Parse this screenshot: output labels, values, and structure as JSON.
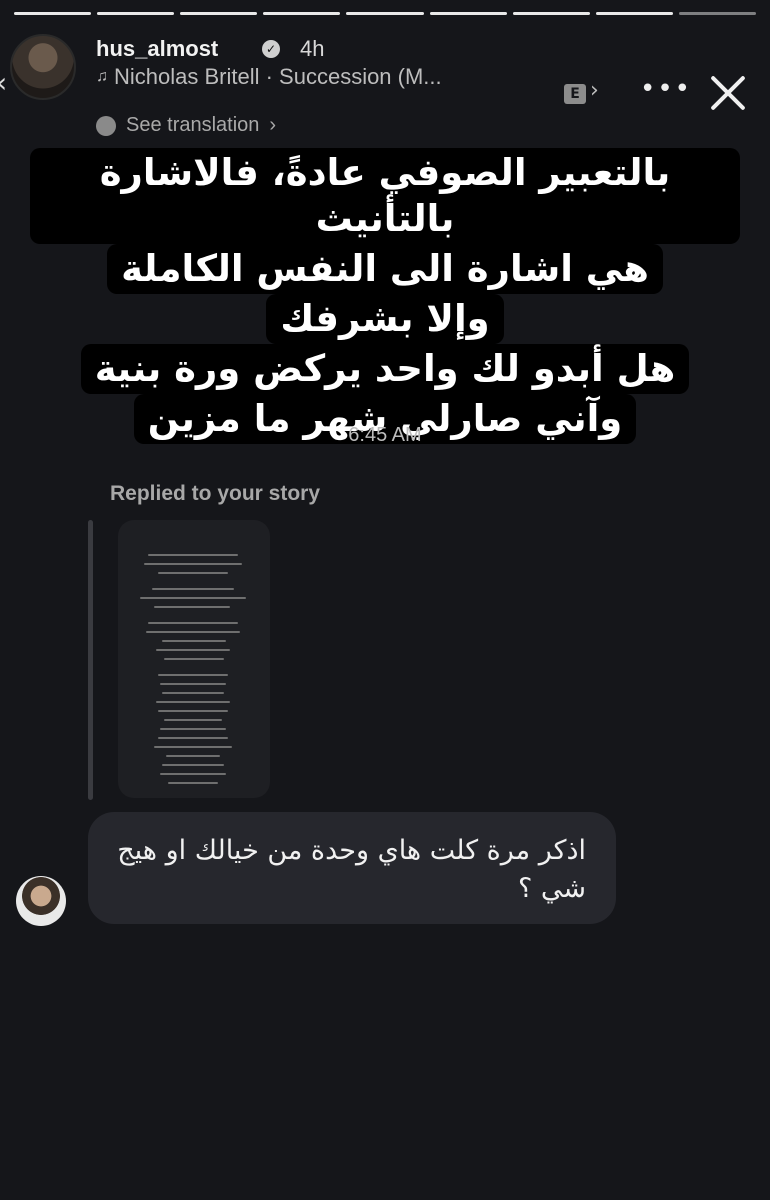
{
  "progress": {
    "segments": 9,
    "completed": 8
  },
  "header": {
    "username": "hus_almost",
    "time_ago": "4h",
    "music": "Nicholas Britell · Succession (M...",
    "explicit_badge": "E",
    "see_translation": "See translation"
  },
  "story": {
    "lines": [
      "بالتعبير الصوفي عادةً، فالاشارة بالتأنيث",
      "هي اشارة الى النفس الكاملة",
      "وإلا بشرفك",
      "هل أبدو لك واحد يركض ورة بنية",
      "وآني صارلي شهر ما مزين"
    ]
  },
  "chat": {
    "timestamp": "6:45 AM",
    "replied_label": "Replied to your story",
    "message": "اذكر مرة كلت هاي وحدة من خيالك او هيج شي ؟"
  },
  "colors": {
    "background": "#15161a",
    "bubble": "#26272d",
    "text_bg": "#000000"
  }
}
